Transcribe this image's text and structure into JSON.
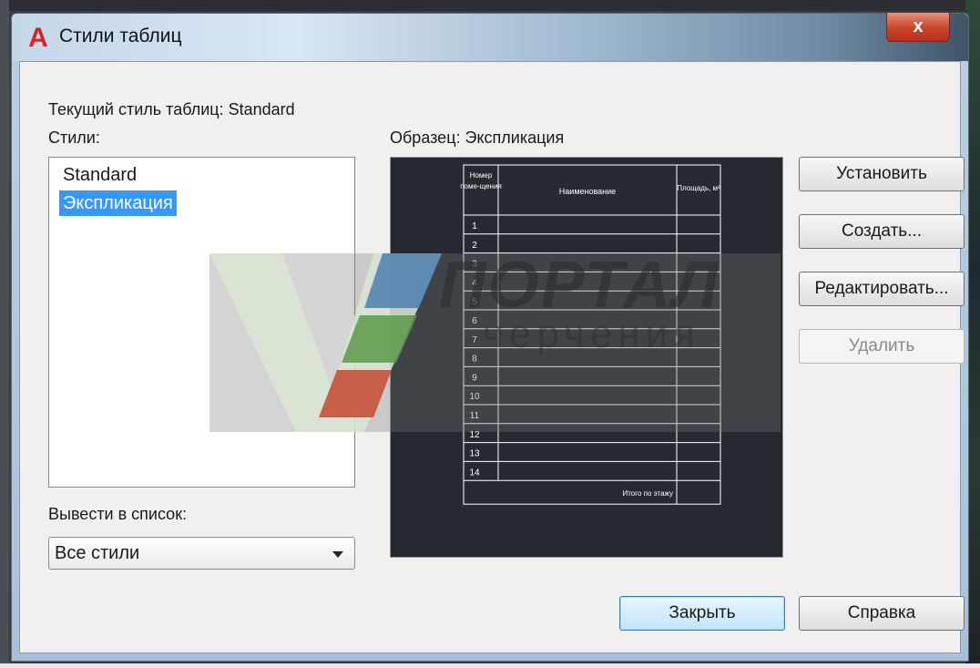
{
  "window": {
    "title": "Стили таблиц",
    "close_glyph": "x"
  },
  "current_style_label": "Текущий стиль таблиц: Standard",
  "styles_label": "Стили:",
  "styles_list": [
    {
      "label": "Standard",
      "selected": false
    },
    {
      "label": "Экспликация",
      "selected": true
    }
  ],
  "list_filter": {
    "label": "Вывести в список:",
    "value": "Все стили"
  },
  "preview": {
    "label": "Образец: Экспликация",
    "table": {
      "headers": [
        "Номер поме-щения",
        "Наименование",
        "Площадь, м²"
      ],
      "rows": [
        "1",
        "2",
        "3",
        "4",
        "5",
        "6",
        "7",
        "8",
        "9",
        "10",
        "11",
        "12",
        "13",
        "14"
      ],
      "footer": "Итого по этажу"
    }
  },
  "buttons": {
    "set_current": "Установить",
    "create": "Создать...",
    "edit": "Редактировать...",
    "delete": "Удалить",
    "close": "Закрыть",
    "help": "Справка"
  },
  "watermark": {
    "line1": "ПОРТАЛ",
    "line2": "черчения"
  },
  "colors": {
    "selection": "#3399ff",
    "preview_bg": "#262a30",
    "app_icon": "#dd2222"
  }
}
